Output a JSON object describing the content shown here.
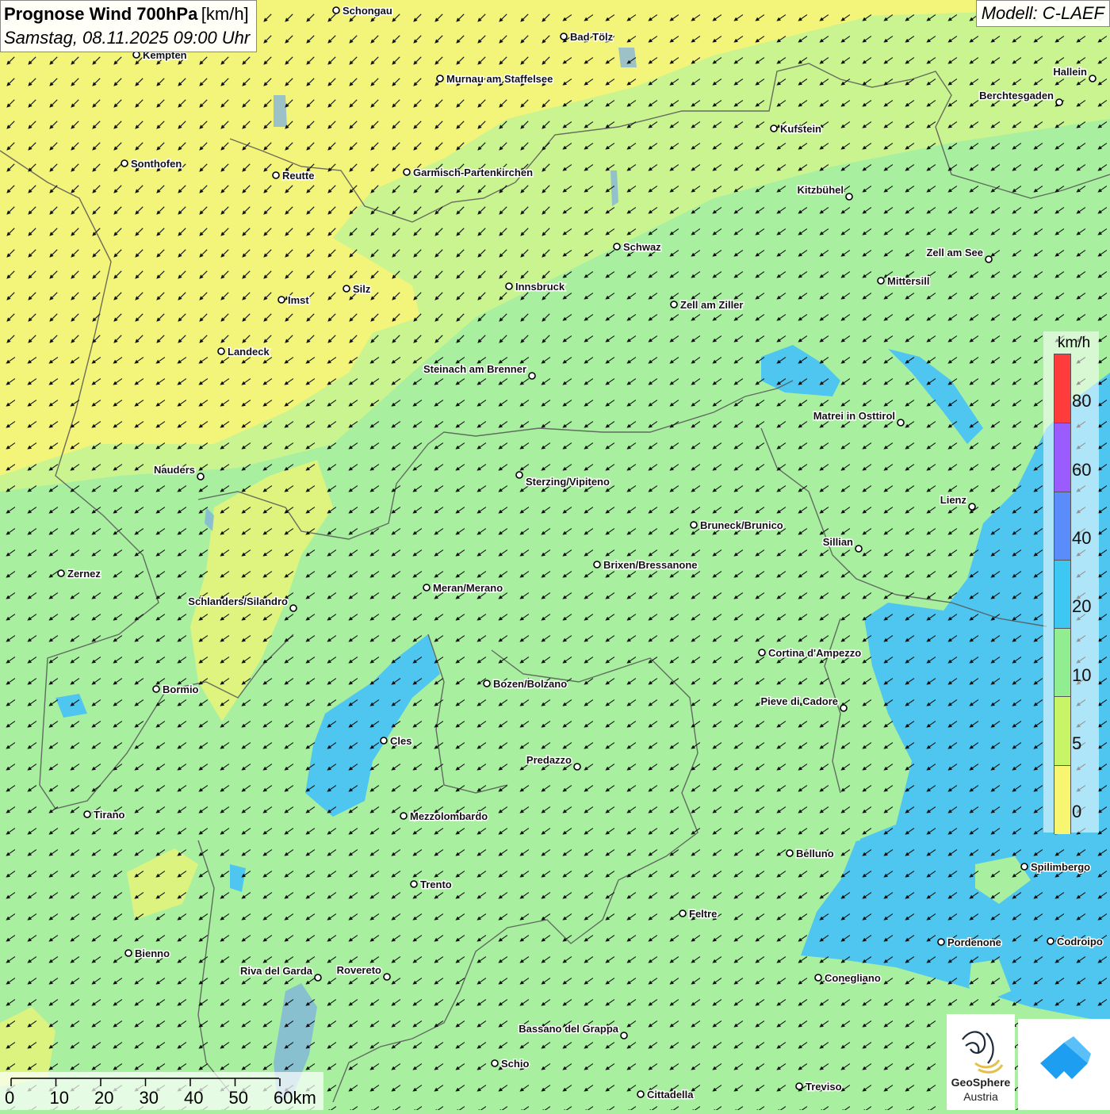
{
  "title": {
    "main": "Prognose Wind 700hPa",
    "unit": "[km/h]",
    "date": "Samstag, 08.11.2025 09:00 Uhr"
  },
  "model": "Modell: C-LAEF",
  "legend": {
    "unit": "km/h",
    "ticks": [
      "80",
      "60",
      "40",
      "20",
      "10",
      "5",
      "0"
    ],
    "colors": [
      "#ff3b3b",
      "#9a5cff",
      "#5b8dfa",
      "#3dc8f4",
      "#90ee90",
      "#c8f565",
      "#f8f670"
    ]
  },
  "scale": {
    "labels": [
      "0",
      "10",
      "20",
      "30",
      "40",
      "50",
      "60km"
    ]
  },
  "logo": {
    "line1": "GeoSphere",
    "line2": "Austria"
  },
  "cities": [
    {
      "name": "Schongau"
    },
    {
      "name": "Bad Tölz"
    },
    {
      "name": "Kempten"
    },
    {
      "name": "Murnau am Staffelsee"
    },
    {
      "name": "Hallein"
    },
    {
      "name": "Berchtesgaden"
    },
    {
      "name": "Kufstein"
    },
    {
      "name": "Sonthofen"
    },
    {
      "name": "Reutte"
    },
    {
      "name": "Garmisch-Partenkirchen"
    },
    {
      "name": "Kitzbühel"
    },
    {
      "name": "Schwaz"
    },
    {
      "name": "Zell am See"
    },
    {
      "name": "Mittersill"
    },
    {
      "name": "Innsbruck"
    },
    {
      "name": "Imst"
    },
    {
      "name": "Silz"
    },
    {
      "name": "Zell am Ziller"
    },
    {
      "name": "Landeck"
    },
    {
      "name": "Steinach am Brenner"
    },
    {
      "name": "Matrei in Osttirol"
    },
    {
      "name": "Nauders"
    },
    {
      "name": "Sterzing/Vipiteno"
    },
    {
      "name": "Lienz"
    },
    {
      "name": "Bruneck/Brunico"
    },
    {
      "name": "Sillian"
    },
    {
      "name": "Zernez"
    },
    {
      "name": "Brixen/Bressanone"
    },
    {
      "name": "Meran/Merano"
    },
    {
      "name": "Schlanders/Silandro"
    },
    {
      "name": "Cortina d'Ampezzo"
    },
    {
      "name": "Bormio"
    },
    {
      "name": "Bozen/Bolzano"
    },
    {
      "name": "Pieve di Cadore"
    },
    {
      "name": "Cles"
    },
    {
      "name": "Predazzo"
    },
    {
      "name": "Tirano"
    },
    {
      "name": "Mezzolombardo"
    },
    {
      "name": "Belluno"
    },
    {
      "name": "Spilimbergo"
    },
    {
      "name": "Trento"
    },
    {
      "name": "Feltre"
    },
    {
      "name": "Pordenone"
    },
    {
      "name": "Codroipo"
    },
    {
      "name": "Bienno"
    },
    {
      "name": "Riva del Garda"
    },
    {
      "name": "Rovereto"
    },
    {
      "name": "Conegliano"
    },
    {
      "name": "Bassano del Grappa"
    },
    {
      "name": "Schio"
    },
    {
      "name": "Treviso"
    },
    {
      "name": "Cittadella"
    }
  ]
}
